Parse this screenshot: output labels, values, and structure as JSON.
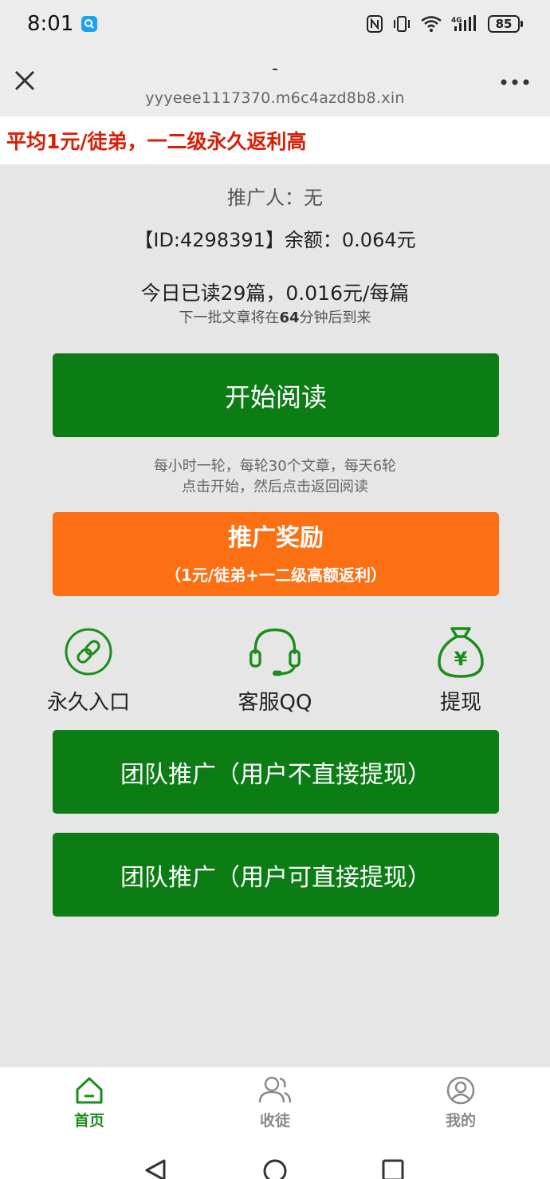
{
  "status_bar": {
    "time": "8:01",
    "battery": "85",
    "network": "4G"
  },
  "nav": {
    "title": "-",
    "url": "yyyeee1117370.m6c4azd8b8.xin"
  },
  "banner": {
    "text": "平均1元/徒弟，一二级永久返利高",
    "color": "#d81e06"
  },
  "info": {
    "promoter": "推广人：无",
    "balance": "【ID:4298391】余额：0.064元",
    "today": "今日已读29篇，0.016元/每篇",
    "next_batch_prefix": "下一批文章将在",
    "next_batch_minutes": "64",
    "next_batch_suffix": "分钟后到来"
  },
  "start_button": {
    "label": "开始阅读"
  },
  "hints": {
    "line1": "每小时一轮，每轮30个文章，每天6轮",
    "line2": "点击开始，然后点击返回阅读"
  },
  "reward_button": {
    "title": "推广奖励",
    "subtitle": "（1元/徒弟+一二级高额返利）"
  },
  "quick_links": [
    {
      "label": "永久入口",
      "icon": "link-icon"
    },
    {
      "label": "客服QQ",
      "icon": "headset-icon"
    },
    {
      "label": "提现",
      "icon": "money-bag-icon"
    }
  ],
  "team_buttons": {
    "team1": "团队推广（用户不直接提现）",
    "team2": "团队推广（用户可直接提现）"
  },
  "tabs": [
    {
      "label": "首页",
      "icon": "home-icon",
      "active": true
    },
    {
      "label": "收徒",
      "icon": "users-icon",
      "active": false
    },
    {
      "label": "我的",
      "icon": "user-icon",
      "active": false
    }
  ],
  "colors": {
    "primary_green": "#0c7d14",
    "accent_orange": "#fc6f12",
    "active_tab": "#1a8d1a",
    "background": "#e6e6e6"
  }
}
